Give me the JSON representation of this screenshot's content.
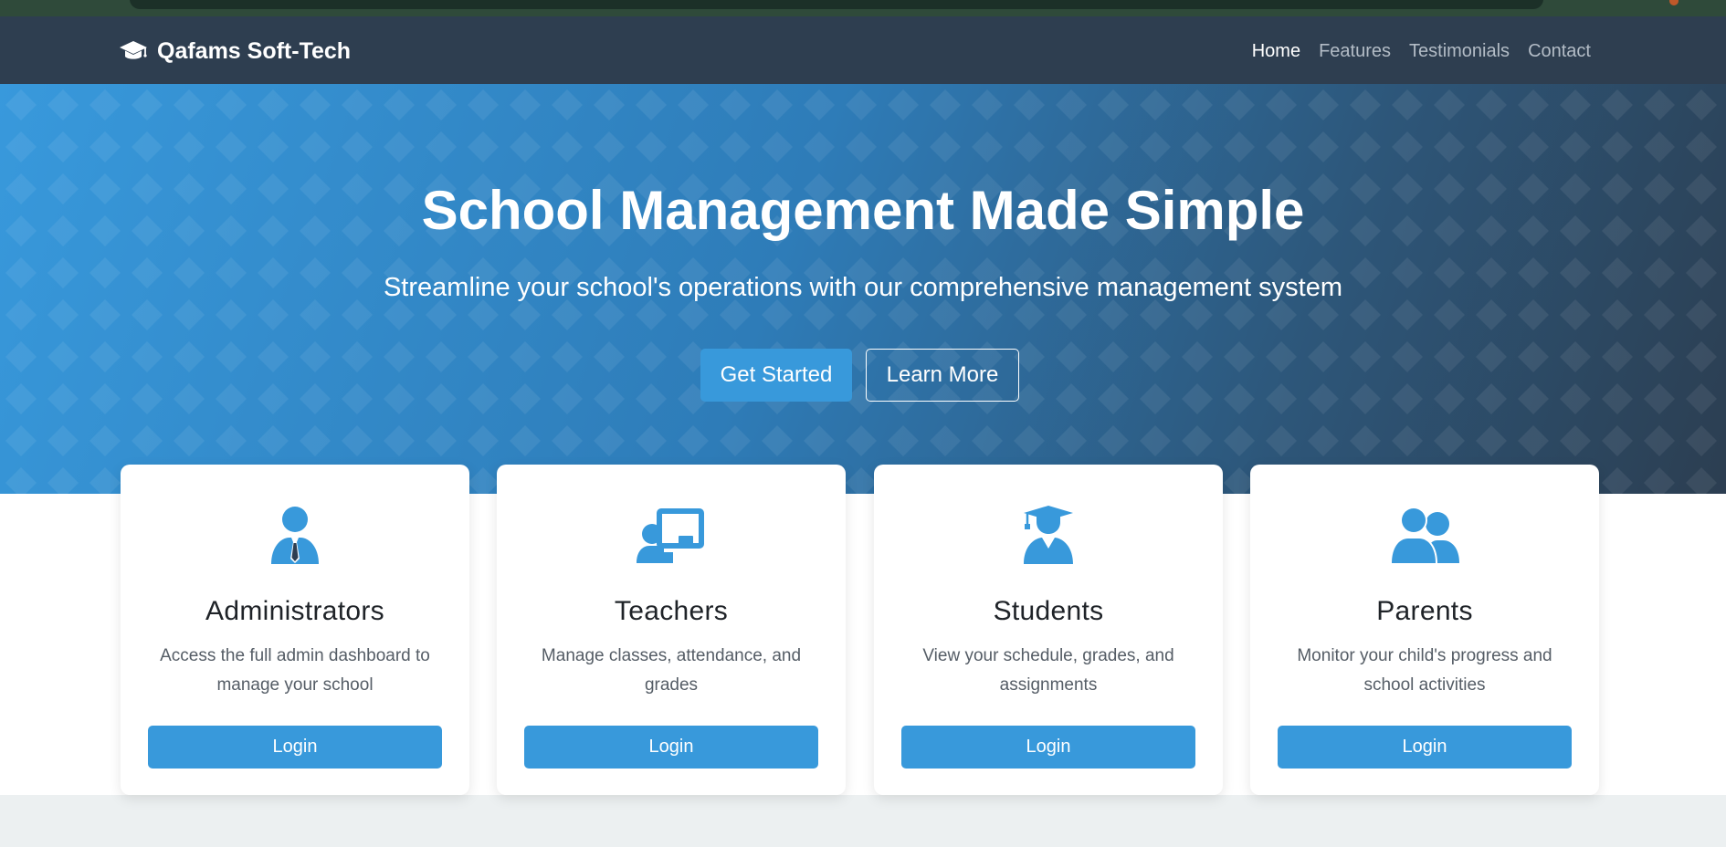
{
  "navbar": {
    "brand": "Qafams Soft-Tech",
    "brand_icon": "graduation-cap-icon",
    "links": [
      {
        "label": "Home",
        "active": true
      },
      {
        "label": "Features",
        "active": false
      },
      {
        "label": "Testimonials",
        "active": false
      },
      {
        "label": "Contact",
        "active": false
      }
    ]
  },
  "hero": {
    "title": "School Management Made Simple",
    "subtitle": "Streamline your school's operations with our comprehensive management system",
    "primary_button": "Get Started",
    "secondary_button": "Learn More"
  },
  "roles": [
    {
      "title": "Administrators",
      "description": "Access the full admin dashboard to manage your school",
      "button": "Login",
      "icon": "user-tie-icon"
    },
    {
      "title": "Teachers",
      "description": "Manage classes, attendance, and grades",
      "button": "Login",
      "icon": "chalkboard-teacher-icon"
    },
    {
      "title": "Students",
      "description": "View your schedule, grades, and assignments",
      "button": "Login",
      "icon": "user-graduate-icon"
    },
    {
      "title": "Parents",
      "description": "Monitor your child's progress and school activities",
      "button": "Login",
      "icon": "users-icon"
    }
  ],
  "colors": {
    "accent": "#3899db",
    "navbar_bg": "#2e3e50",
    "hero_gradient_start": "#3899dc",
    "hero_gradient_end": "#2c3e51",
    "page_bg": "#ecf0f1"
  }
}
